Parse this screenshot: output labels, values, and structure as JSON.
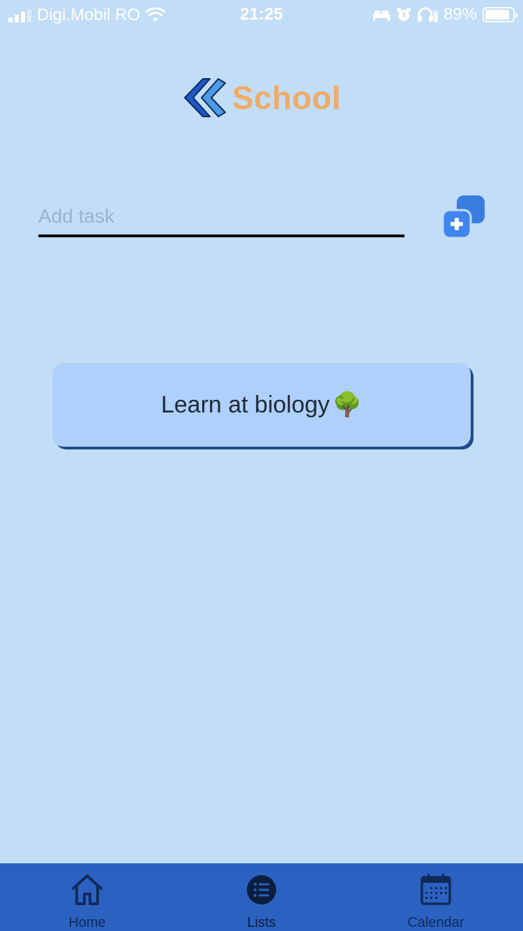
{
  "status_bar": {
    "carrier": "Digi.Mobil RO",
    "time": "21:25",
    "battery_percent": "89%",
    "battery_level": 0.89,
    "icons": [
      "signal-icon",
      "wifi-icon",
      "bed-icon",
      "alarm-icon",
      "headphones-icon",
      "battery-icon"
    ]
  },
  "header": {
    "title": "School",
    "back_icon": "double-chevron-left-icon",
    "title_color": "#efab68"
  },
  "task_input": {
    "placeholder": "Add task",
    "value": ""
  },
  "add_button": {
    "icon": "add-copy-icon"
  },
  "tasks": [
    {
      "text": "Learn at biology",
      "emoji": "🌳"
    }
  ],
  "tab_bar": {
    "background": "#2b62c1",
    "items": [
      {
        "label": "Home",
        "icon": "home-icon",
        "active": false
      },
      {
        "label": "Lists",
        "icon": "list-icon",
        "active": true
      },
      {
        "label": "Calendar",
        "icon": "calendar-icon",
        "active": false
      }
    ]
  },
  "colors": {
    "background": "#c2ddf6",
    "card": "#aed0fa",
    "card_shadow": "#1f4a8a",
    "accent_blue": "#3a7de0"
  }
}
